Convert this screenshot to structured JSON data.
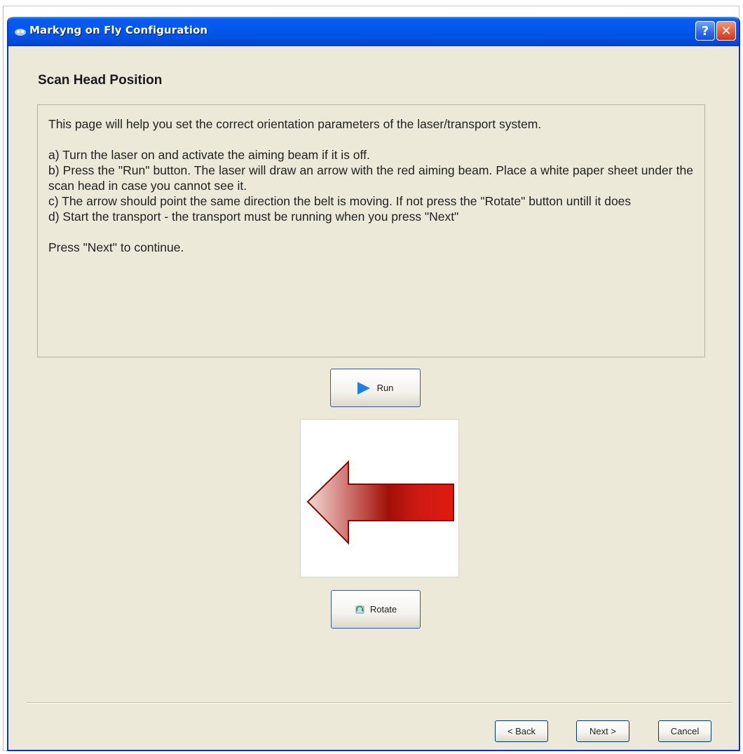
{
  "window": {
    "title": "Markyng on Fly Configuration",
    "help_label": "?",
    "close_label": "✕"
  },
  "page": {
    "heading": "Scan Head Position"
  },
  "instructions": {
    "intro": "This page will help you set the correct orientation parameters of the laser/transport system.",
    "step_a": "a) Turn the laser on and activate the aiming beam if it is off.",
    "step_b": "b) Press the \"Run\" button. The laser will draw an arrow with the red aiming beam. Place a white paper sheet under the scan head in case you cannot see it.",
    "step_c": "c) The arrow should point the same direction the belt is moving. If not press the \"Rotate\" button untill it does",
    "step_d": "d) Start the transport - the transport must be running when you press \"Next\"",
    "outro": "Press \"Next\" to continue."
  },
  "controls": {
    "run_label": "Run",
    "rotate_label": "Rotate"
  },
  "preview": {
    "arrow_direction": "left",
    "arrow_color": "#d2140e"
  },
  "footer": {
    "back_label": "< Back",
    "next_label": "Next >",
    "cancel_label": "Cancel"
  },
  "colors": {
    "titlebar": "#0058ee",
    "dialog_bg": "#ece9d8",
    "run_icon": "#1e7fe6"
  }
}
